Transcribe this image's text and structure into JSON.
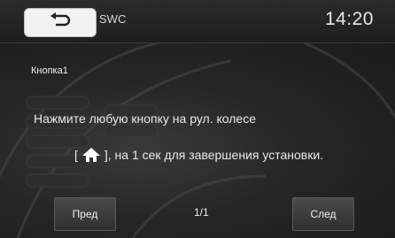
{
  "header": {
    "title": "SWC",
    "clock": "14:20"
  },
  "main": {
    "button_label": "Кнопка1",
    "instruction_line1": "Нажмите любую кнопку на рул. колесе",
    "instruction_prefix": "[",
    "instruction_suffix": "], на 1 сек для завершения установки."
  },
  "footer": {
    "prev_label": "Пред",
    "page_indicator": "1/1",
    "next_label": "След"
  }
}
